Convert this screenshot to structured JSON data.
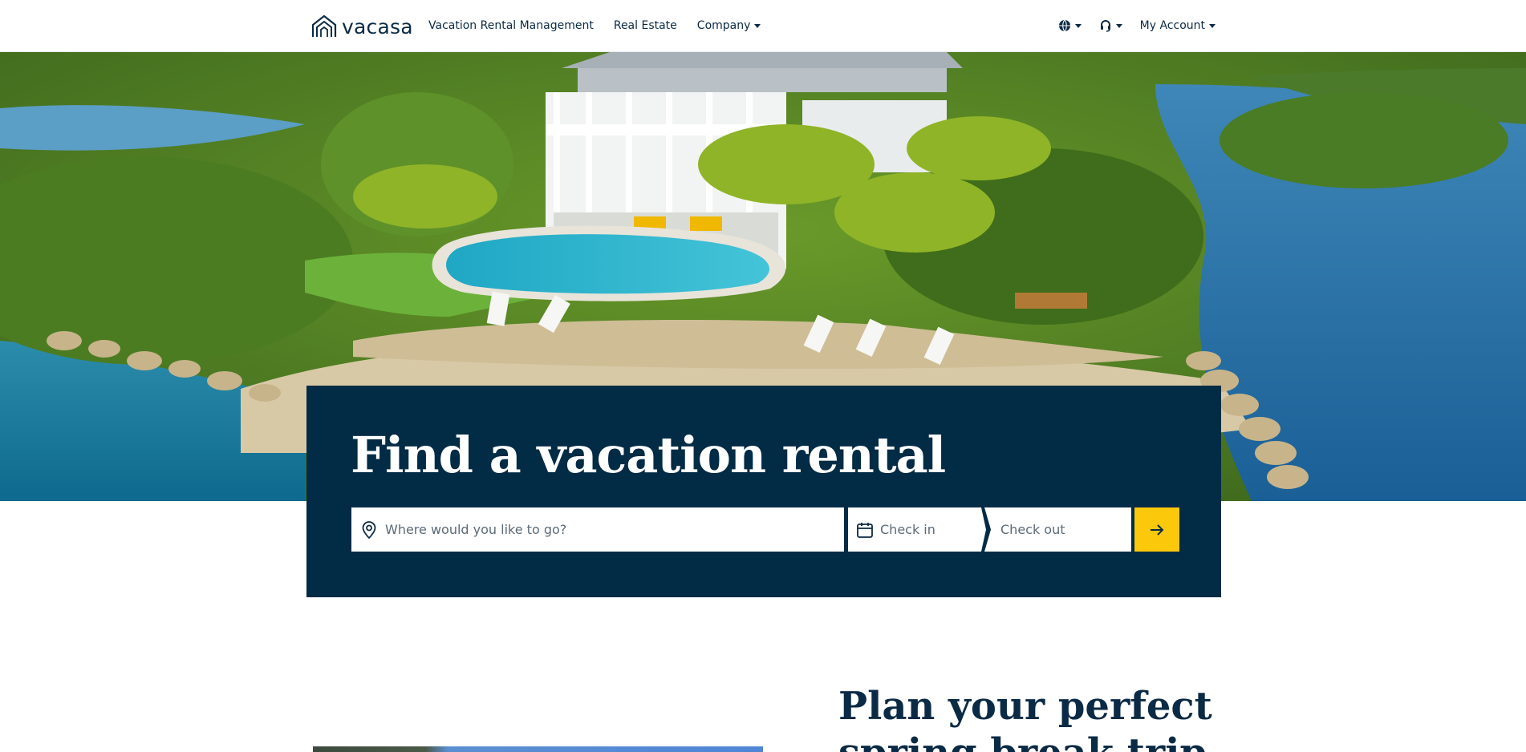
{
  "header": {
    "logo_text": "vacasa",
    "nav": [
      {
        "label": "Vacation Rental Management"
      },
      {
        "label": "Real Estate"
      },
      {
        "label": "Company"
      }
    ],
    "account_label": "My Account",
    "language_icon": "globe-icon",
    "support_icon": "headset-icon"
  },
  "search": {
    "title": "Find a vacation rental",
    "where_placeholder": "Where would you like to go?",
    "checkin_label": "Check in",
    "checkout_label": "Check out",
    "submit_icon": "arrow-right-icon"
  },
  "promo": {
    "title": "Plan your perfect spring break trip"
  },
  "colors": {
    "navy": "#022b45",
    "accent_yellow": "#fcc80c",
    "text": "#0b2a45"
  }
}
